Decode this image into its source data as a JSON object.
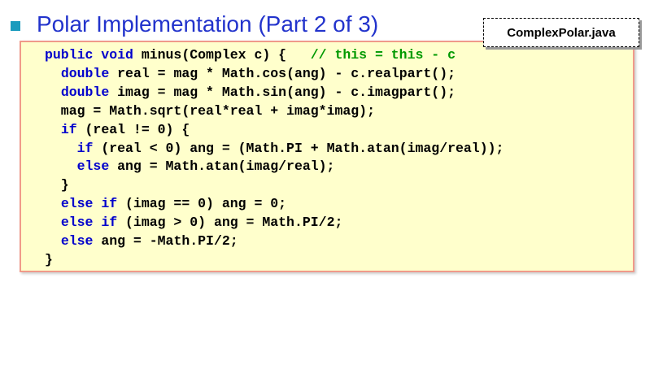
{
  "slide": {
    "title": "Polar Implementation (Part 2 of 3)",
    "filename": "ComplexPolar.java"
  },
  "code": {
    "lines": [
      [
        {
          "t": "public void",
          "k": "kw"
        },
        {
          "t": " minus(Complex c) {   ",
          "k": "pl"
        },
        {
          "t": "// this = this - c",
          "k": "cm"
        }
      ],
      [
        {
          "t": "  ",
          "k": "pl"
        },
        {
          "t": "double",
          "k": "kw"
        },
        {
          "t": " real = mag * Math.cos(ang) - c.realpart();",
          "k": "pl"
        }
      ],
      [
        {
          "t": "  ",
          "k": "pl"
        },
        {
          "t": "double",
          "k": "kw"
        },
        {
          "t": " imag = mag * Math.sin(ang) - c.imagpart();",
          "k": "pl"
        }
      ],
      [
        {
          "t": "  mag = Math.sqrt(real*real + imag*imag);",
          "k": "pl"
        }
      ],
      [
        {
          "t": "  ",
          "k": "pl"
        },
        {
          "t": "if",
          "k": "kw"
        },
        {
          "t": " (real != 0) {",
          "k": "pl"
        }
      ],
      [
        {
          "t": "    ",
          "k": "pl"
        },
        {
          "t": "if",
          "k": "kw"
        },
        {
          "t": " (real < 0) ang = (Math.PI + Math.atan(imag/real));",
          "k": "pl"
        }
      ],
      [
        {
          "t": "    ",
          "k": "pl"
        },
        {
          "t": "else",
          "k": "kw"
        },
        {
          "t": " ang = Math.atan(imag/real);",
          "k": "pl"
        }
      ],
      [
        {
          "t": "  }",
          "k": "pl"
        }
      ],
      [
        {
          "t": "  ",
          "k": "pl"
        },
        {
          "t": "else if",
          "k": "kw"
        },
        {
          "t": " (imag == 0) ang = 0;",
          "k": "pl"
        }
      ],
      [
        {
          "t": "  ",
          "k": "pl"
        },
        {
          "t": "else if",
          "k": "kw"
        },
        {
          "t": " (imag > 0) ang = Math.PI/2;",
          "k": "pl"
        }
      ],
      [
        {
          "t": "  ",
          "k": "pl"
        },
        {
          "t": "else",
          "k": "kw"
        },
        {
          "t": " ang = -Math.PI/2;",
          "k": "pl"
        }
      ],
      [
        {
          "t": "}",
          "k": "pl"
        }
      ]
    ]
  }
}
